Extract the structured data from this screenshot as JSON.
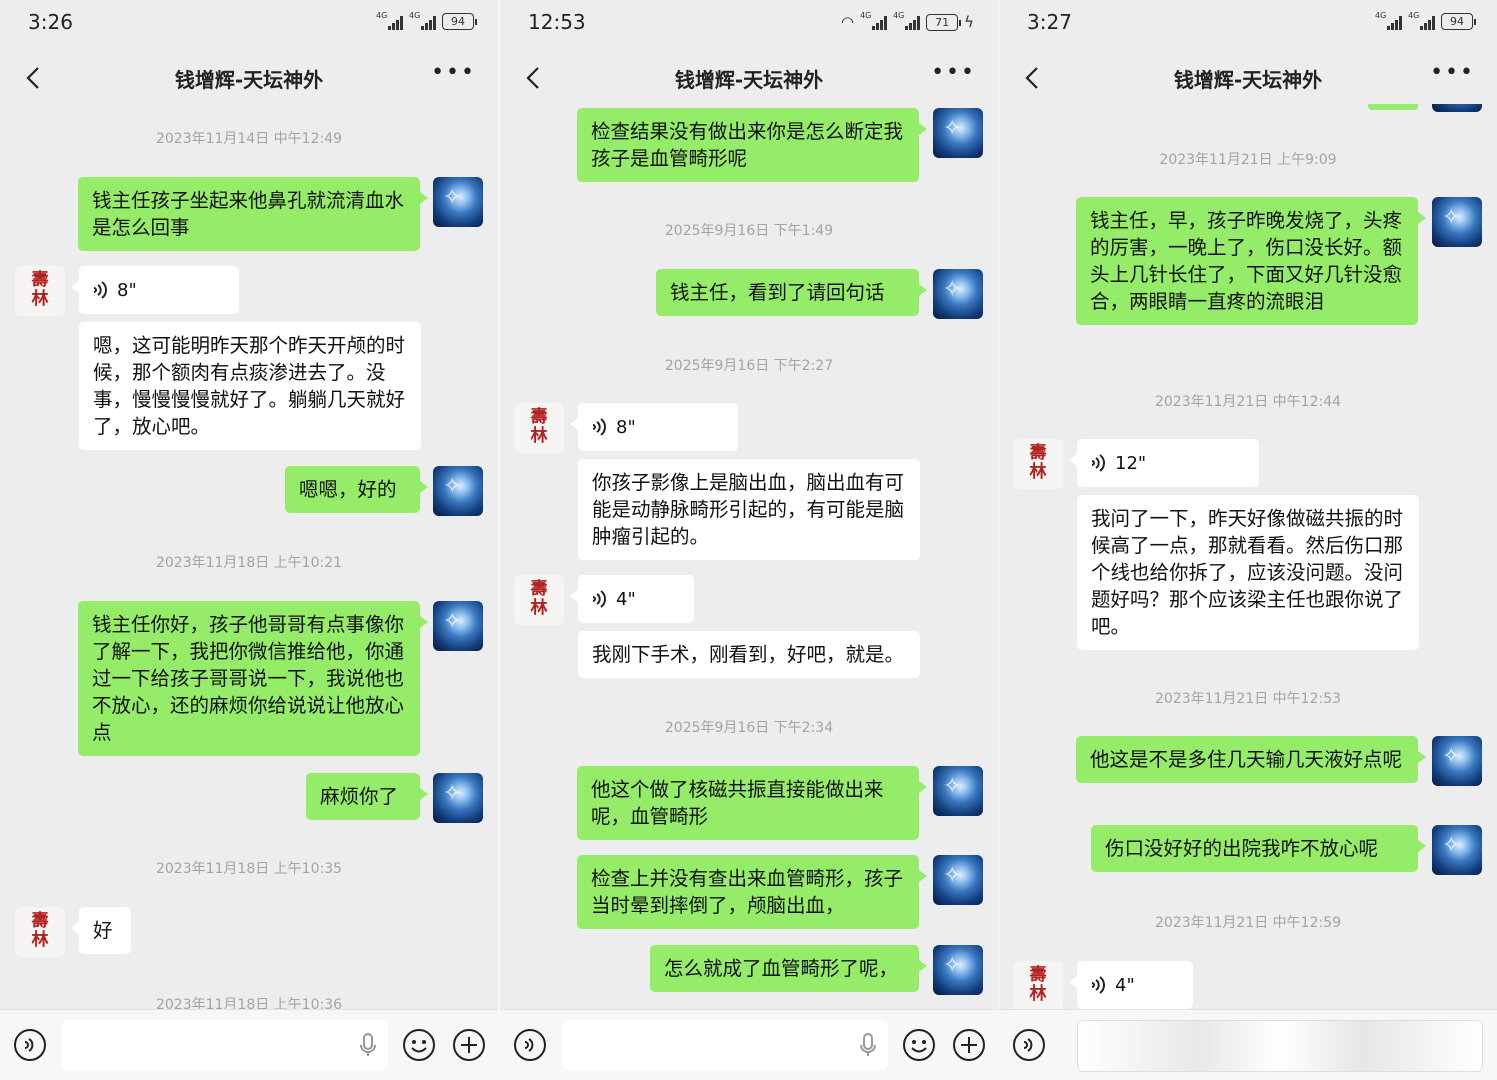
{
  "panel1": {
    "time": "3:26",
    "signal": [
      "4G",
      "4G"
    ],
    "battery": "94",
    "title": "钱增辉-天坛神外",
    "timestamps": [
      "2023年11月14日 中午12:49",
      "2023年11月18日 上午10:21",
      "2023年11月18日 上午10:35",
      "2023年11月18日 上午10:36"
    ],
    "messages": [
      "钱主任孩子坐起来他鼻孔就流清血水是怎么回事",
      "8\"",
      "嗯，这可能明昨天那个昨天开颅的时候，那个额肉有点痰渗进去了。没事，慢慢慢慢就好了。躺躺几天就好了，放心吧。",
      "嗯嗯，好的",
      "钱主任你好，孩子他哥哥有点事像你了解一下，我把你微信推给他，你通过一下给孩子哥哥说一下，我说他也不放心，还的麻烦你给说说让他放心点",
      "麻烦你了",
      "好"
    ]
  },
  "panel2": {
    "time": "12:53",
    "signal": [
      "4G",
      "4G"
    ],
    "battery": "71",
    "title": "钱增辉-天坛神外",
    "timestamps": [
      "2025年9月16日 下午1:49",
      "2025年9月16日 下午2:27",
      "2025年9月16日 下午2:34"
    ],
    "messages": [
      "检查结果没有做出来你是怎么断定我孩子是血管畸形呢",
      "钱主任，看到了请回句话",
      "8\"",
      "你孩子影像上是脑出血，脑出血有可能是动静脉畸形引起的，有可能是脑肿瘤引起的。",
      "4\"",
      "我刚下手术，刚看到，好吧，就是。",
      "他这个做了核磁共振直接能做出来呢，血管畸形",
      "检查上并没有查出来血管畸形，孩子当时晕到摔倒了，颅脑出血，",
      "怎么就成了血管畸形了呢，"
    ]
  },
  "panel3": {
    "time": "3:27",
    "signal": [
      "4G",
      "4G"
    ],
    "battery": "94",
    "title": "钱增辉-天坛神外",
    "timestamps": [
      "2023年11月21日 上午9:09",
      "2023年11月21日 中午12:44",
      "2023年11月21日 中午12:53",
      "2023年11月21日 中午12:59"
    ],
    "messages": [
      "钱主任，早，孩子昨晚发烧了，头疼的厉害，一晚上了，伤口没长好。额头上几针长住了，下面又好几针没愈合，两眼睛一直疼的流眼泪",
      "12\"",
      "我问了一下，昨天好像做磁共振的时候高了一点，那就看看。然后伤口那个线也给你拆了，应该没问题。没问题好吗？那个应该梁主任也跟你说了吧。",
      "他这是不是多住几天输几天液好点呢",
      "伤口没好好的出院我咋不放心呢",
      "4\""
    ]
  },
  "icons": {
    "back": "chevron-left-icon",
    "more": "more-dots-icon",
    "voice_input": "voice-input-icon",
    "mic": "microphone-icon",
    "emoji": "emoji-icon",
    "plus": "plus-icon"
  },
  "colors": {
    "background": "#ededed",
    "bubble_me": "#95ec69",
    "bubble_other": "#ffffff",
    "timestamp": "#a3a3a3"
  }
}
